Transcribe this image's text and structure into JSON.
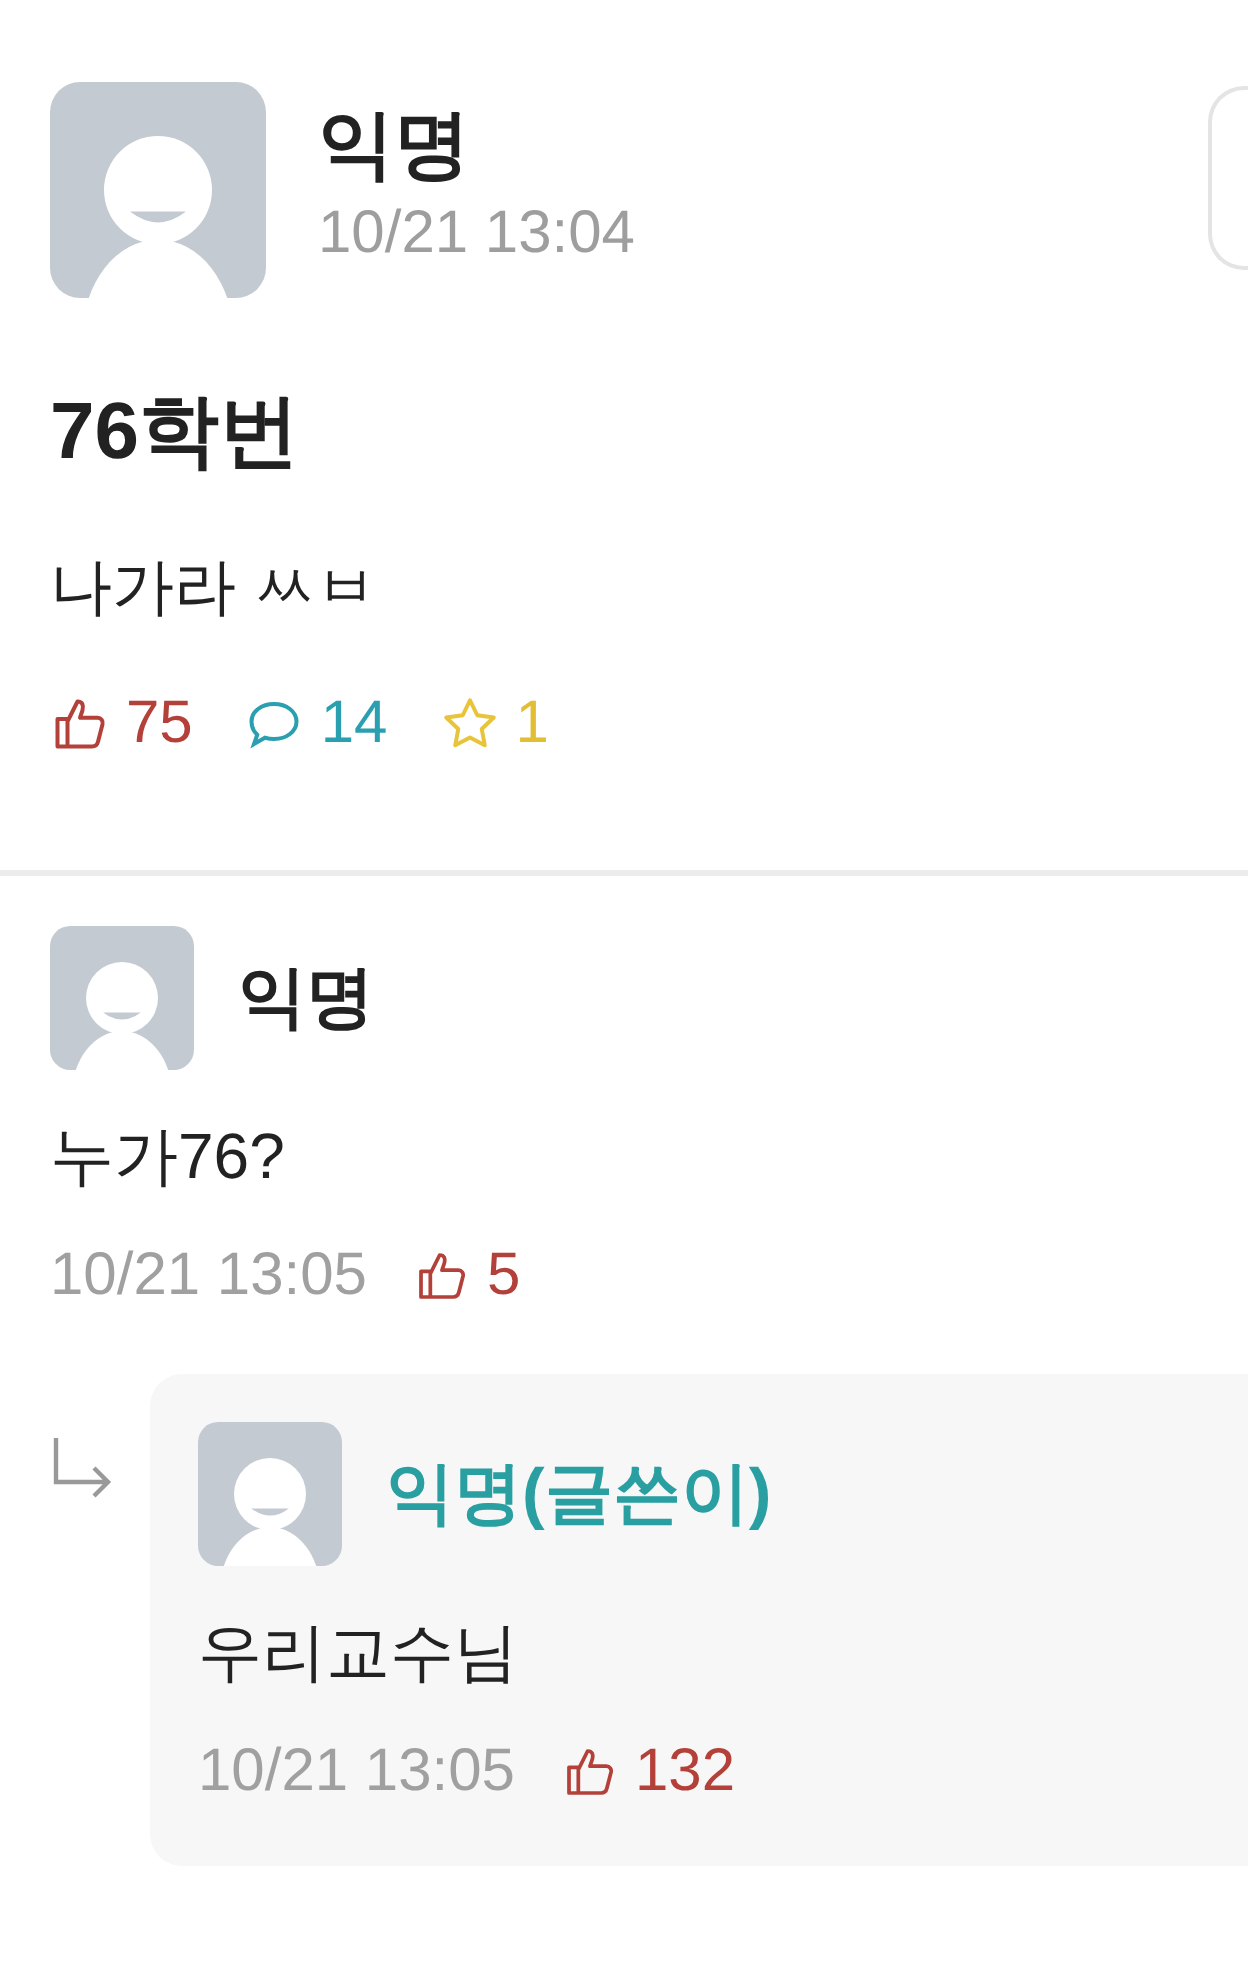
{
  "post": {
    "author": "익명",
    "time": "10/21 13:04",
    "title": "76학번",
    "body": "나가라 ㅆㅂ",
    "likes": "75",
    "comments": "14",
    "scraps": "1"
  },
  "comments": [
    {
      "author": "익명",
      "is_author": false,
      "text": "누가76?",
      "time": "10/21 13:05",
      "likes": "5",
      "reply": false
    },
    {
      "author": "익명(글쓴이)",
      "is_author": true,
      "text": "우리교수님",
      "time": "10/21 13:05",
      "likes": "132",
      "reply": true
    }
  ]
}
